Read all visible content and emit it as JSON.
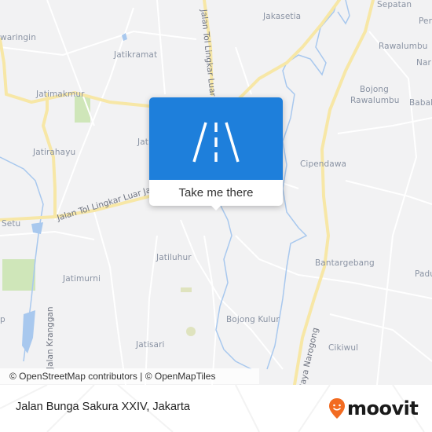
{
  "map": {
    "places": [
      {
        "name": "Jakasetia",
        "id": "jakasetia"
      },
      {
        "name": "Sepatan",
        "id": "sepatan"
      },
      {
        "name": "waringin",
        "id": "waringin"
      },
      {
        "name": "Jatikramat",
        "id": "jatikramat"
      },
      {
        "name": "Rawalumbu",
        "id": "rawalumbu"
      },
      {
        "name": "Per",
        "id": "per"
      },
      {
        "name": "Nar",
        "id": "nar"
      },
      {
        "name": "Jatimakmur",
        "id": "jatimakmur"
      },
      {
        "name": "Bojong",
        "id": "bojong"
      },
      {
        "name": "Rawalumbu",
        "id": "rawalumbu-2"
      },
      {
        "name": "Babal",
        "id": "babal"
      },
      {
        "name": "Jatirahayu",
        "id": "jatirahayu"
      },
      {
        "name": "Jat",
        "id": "jat"
      },
      {
        "name": "Cipendawa",
        "id": "cipendawa"
      },
      {
        "name": "Setu",
        "id": "setu"
      },
      {
        "name": "Jatiluhur",
        "id": "jatiluhur"
      },
      {
        "name": "Bantargebang",
        "id": "bantargebang"
      },
      {
        "name": "Jatimurni",
        "id": "jatimurni"
      },
      {
        "name": "Padu",
        "id": "padu"
      },
      {
        "name": "p",
        "id": "p"
      },
      {
        "name": "Bojong Kulur",
        "id": "bojong-kulur"
      },
      {
        "name": "Jatisari",
        "id": "jatisari"
      },
      {
        "name": "Cikiwul",
        "id": "cikiwul"
      }
    ],
    "roads": [
      {
        "name": "Jalan Tol Lingkar Luar Jakarta",
        "id": "tol-vertical"
      },
      {
        "name": "Jalan Tol Lingkar Luar Jak",
        "id": "tol-horizontal"
      },
      {
        "name": "Jalan Kranggan",
        "id": "kranggan"
      },
      {
        "name": "Raya Narogong",
        "id": "narogong"
      }
    ],
    "attribution": "© OpenStreetMap contributors | © OpenMapTiles"
  },
  "popup": {
    "icon": "road-icon",
    "action_label": "Take me there",
    "header_color": "#1e7fdb"
  },
  "footer": {
    "address": "Jalan Bunga Sakura XXIV, Jakarta",
    "brand": "moovit",
    "brand_color": "#f26b21"
  }
}
